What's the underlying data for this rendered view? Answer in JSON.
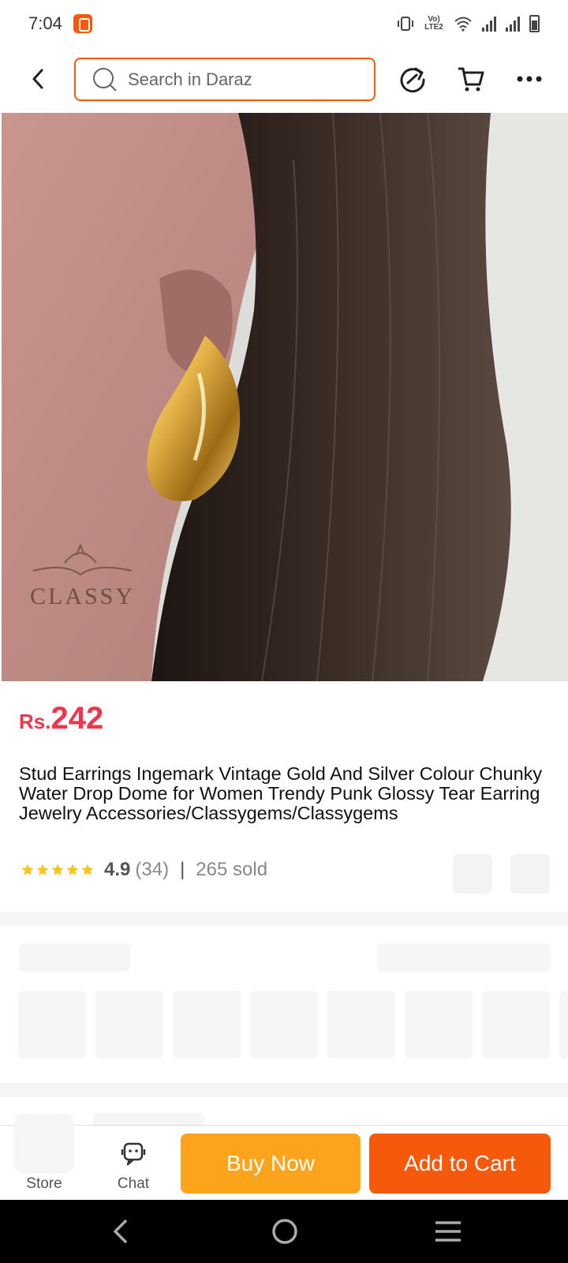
{
  "status_bar": {
    "time": "7:04",
    "network_label": "Vo) LTE2",
    "icons": [
      "daraz-app-icon",
      "vibrate-icon",
      "volte-icon",
      "wifi-icon",
      "signal-icon",
      "signal-icon",
      "battery-icon"
    ]
  },
  "header": {
    "search_placeholder": "Search in Daraz",
    "icons": [
      "back-arrow-icon",
      "search-icon",
      "share-icon",
      "cart-icon",
      "more-icon"
    ]
  },
  "product": {
    "image_alt": "Gold water drop earring worn on ear",
    "watermark_text": "CLASSY",
    "price_currency": "Rs.",
    "price_amount": "242",
    "title": "Stud Earrings Ingemark Vintage Gold And Silver Colour Chunky Water Drop Dome for Women Trendy Punk Glossy Tear Earring Jewelry Accessories/Classygems/Classygems",
    "rating": "4.9",
    "reviews": "(34)",
    "separator": "|",
    "sold": "265 sold",
    "star_count": 5
  },
  "action_bar": {
    "store_label": "Store",
    "chat_label": "Chat",
    "buy_now_label": "Buy Now",
    "add_to_cart_label": "Add to Cart"
  },
  "colors": {
    "brand_orange": "#f5590c",
    "buy_now": "#fda41c",
    "price_red": "#f0344a",
    "star_yellow": "#fcc419"
  },
  "nav_bar": {
    "icons": [
      "nav-back-icon",
      "nav-home-icon",
      "nav-menu-icon"
    ]
  }
}
